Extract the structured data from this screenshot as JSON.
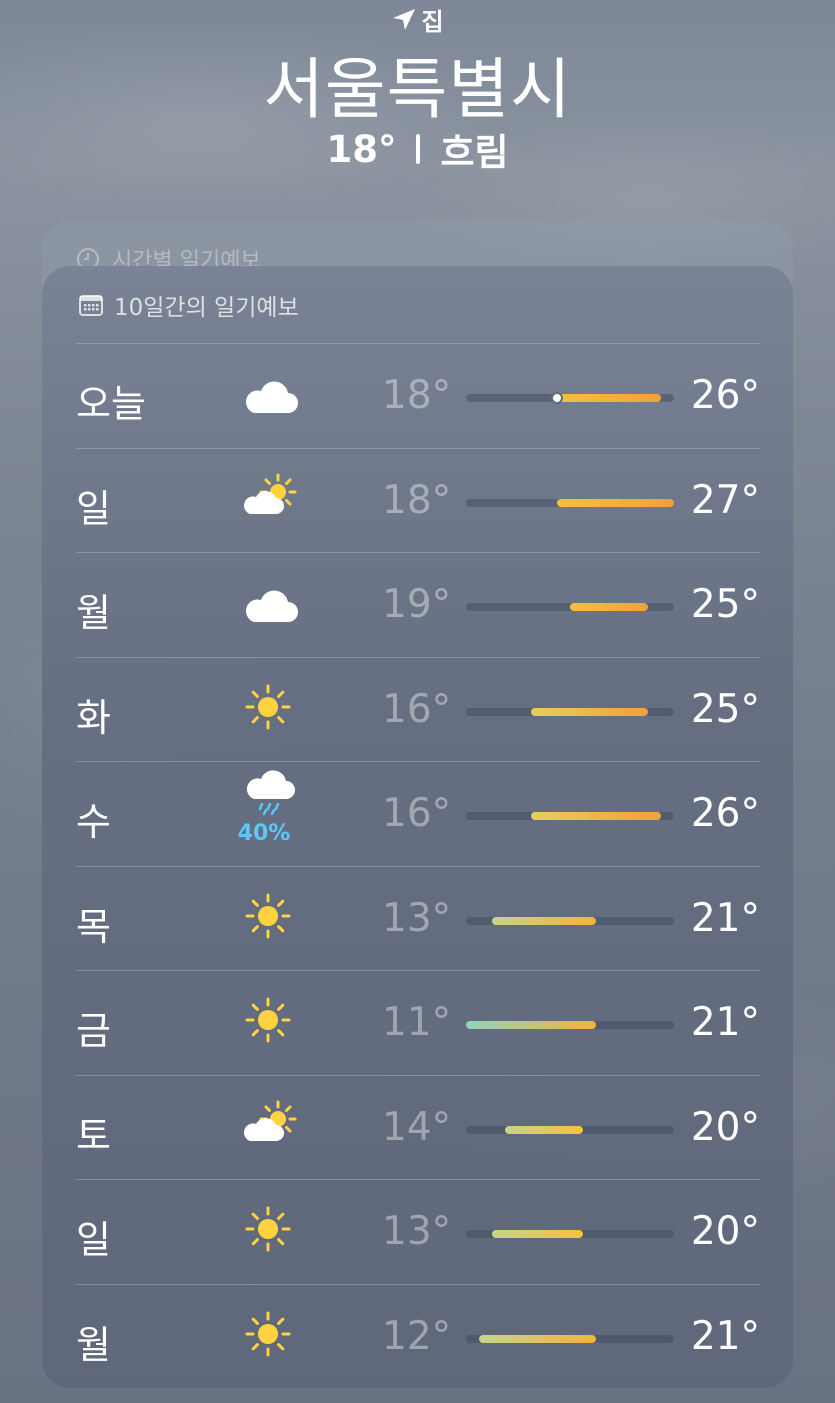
{
  "header": {
    "location_label": "집",
    "city": "서울특별시",
    "temperature": "18°",
    "condition": "흐림"
  },
  "hourly": {
    "label": "시간별 일기예보"
  },
  "forecast": {
    "label": "10일간의 일기예보",
    "range_min": 11,
    "range_max": 27,
    "current_temp": 18,
    "days": [
      {
        "day": "오늘",
        "icon": "cloud-icon",
        "low": "18°",
        "high": "26°",
        "lo": 18,
        "hi": 26,
        "current": true
      },
      {
        "day": "일",
        "icon": "partly-sunny-icon",
        "low": "18°",
        "high": "27°",
        "lo": 18,
        "hi": 27
      },
      {
        "day": "월",
        "icon": "cloud-icon",
        "low": "19°",
        "high": "25°",
        "lo": 19,
        "hi": 25
      },
      {
        "day": "화",
        "icon": "sun-icon",
        "low": "16°",
        "high": "25°",
        "lo": 16,
        "hi": 25
      },
      {
        "day": "수",
        "icon": "rain-cloud-icon",
        "precip": "40%",
        "low": "16°",
        "high": "26°",
        "lo": 16,
        "hi": 26
      },
      {
        "day": "목",
        "icon": "sun-icon",
        "low": "13°",
        "high": "21°",
        "lo": 13,
        "hi": 21
      },
      {
        "day": "금",
        "icon": "sun-icon",
        "low": "11°",
        "high": "21°",
        "lo": 11,
        "hi": 21
      },
      {
        "day": "토",
        "icon": "partly-sunny-icon",
        "low": "14°",
        "high": "20°",
        "lo": 14,
        "hi": 20
      },
      {
        "day": "일",
        "icon": "sun-icon",
        "low": "13°",
        "high": "20°",
        "lo": 13,
        "hi": 20
      },
      {
        "day": "월",
        "icon": "sun-icon",
        "low": "12°",
        "high": "21°",
        "lo": 12,
        "hi": 21
      }
    ]
  }
}
